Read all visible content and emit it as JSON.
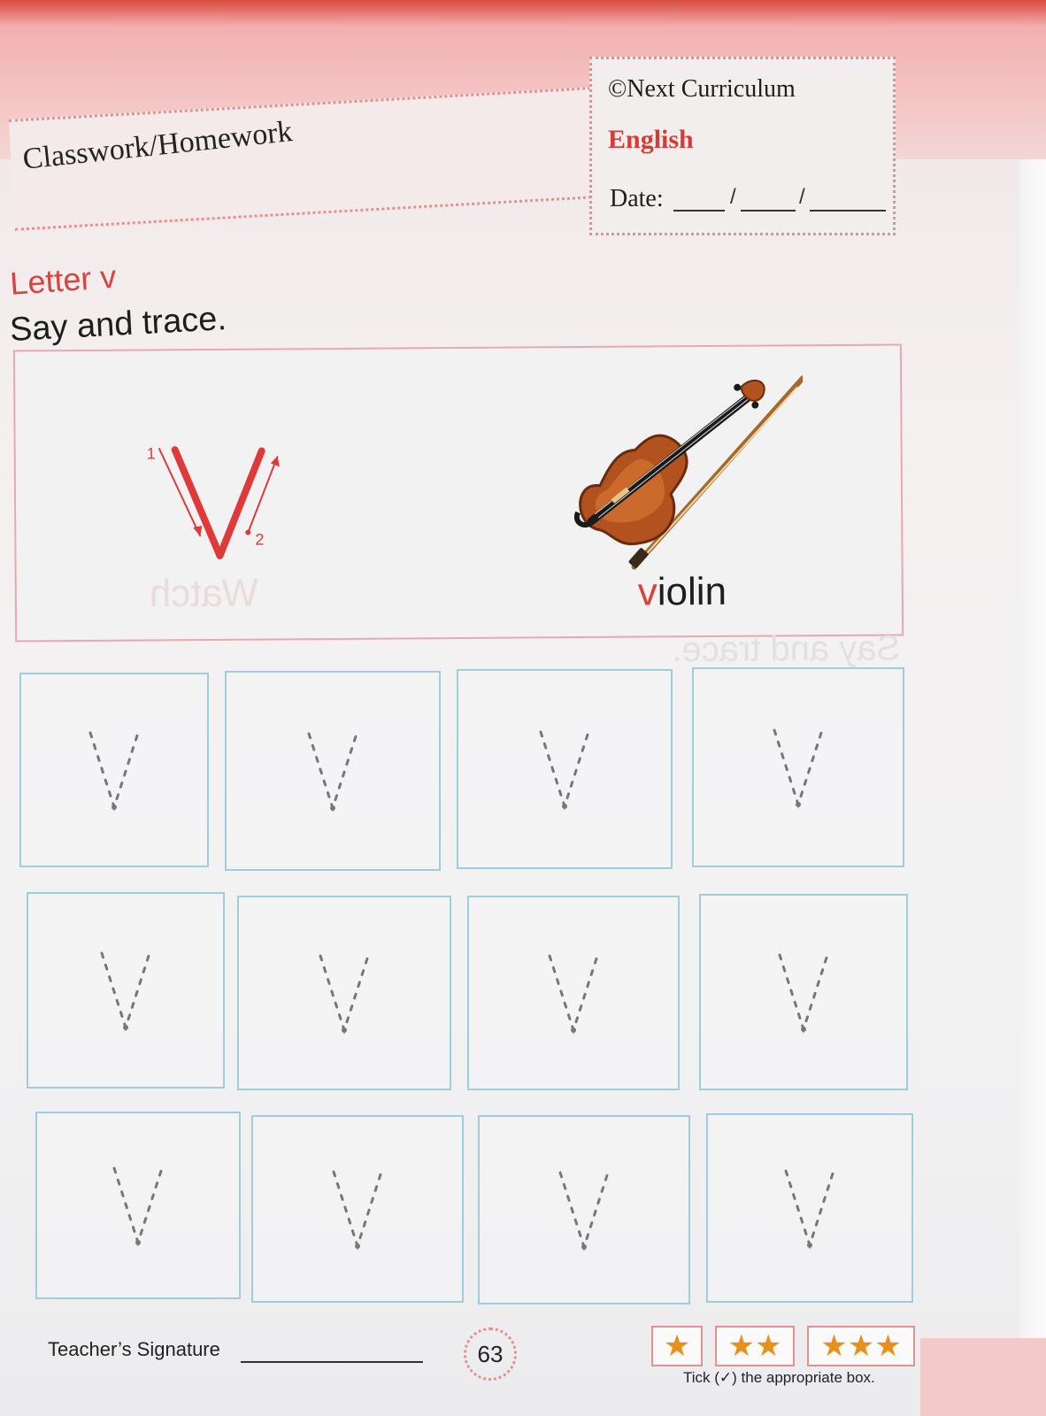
{
  "header": {
    "banner_title": "Classwork/Homework",
    "copyright": "©Next Curriculum",
    "subject": "English",
    "date_label": "Date:",
    "date_sep_1": "/",
    "date_sep_2": "/"
  },
  "lesson": {
    "title": "Letter v",
    "instruction": "Say and trace.",
    "letter": "v",
    "stroke_1": "1",
    "stroke_2": "2",
    "ghost_word": "Watch",
    "ghost_instruction": "Say and trace."
  },
  "example": {
    "word_first": "v",
    "word_rest": "iolin",
    "picture": "violin-icon"
  },
  "trace_grid": {
    "rows": 3,
    "cols": 4,
    "letter": "v"
  },
  "footer": {
    "signature_label": "Teacher’s Signature",
    "page_number": "63",
    "star_1": "★",
    "star_2": "★★",
    "star_3": "★★★",
    "tick_note": "Tick (✓) the appropriate box."
  },
  "colors": {
    "accent_red": "#d8433f",
    "pink_border": "#e58f8f",
    "trace_border": "#9fcde0",
    "star": "#e8901d"
  }
}
